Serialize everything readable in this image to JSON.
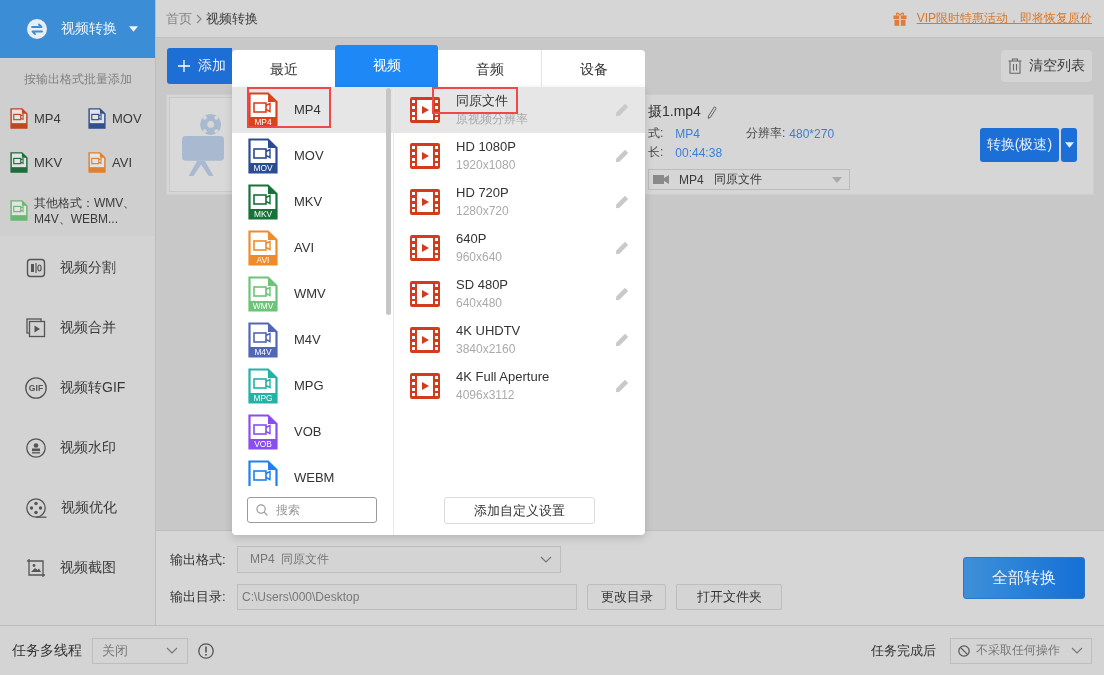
{
  "sidebar": {
    "module": {
      "title": "视频转换"
    },
    "batch_label": "按输出格式批量添加",
    "formats": [
      {
        "label": "MP4",
        "color": "#c04720"
      },
      {
        "label": "MOV",
        "color": "#32508f"
      },
      {
        "label": "MKV",
        "color": "#1e6e3d"
      },
      {
        "label": "AVI",
        "color": "#e0812f"
      }
    ],
    "other_formats": {
      "label": "其他格式：WMV、M4V、WEBM...",
      "color": "#6ab774"
    },
    "tools": [
      {
        "label": "视频分割",
        "kind": "split"
      },
      {
        "label": "视频合并",
        "kind": "merge"
      },
      {
        "label": "视频转GIF",
        "kind": "gif",
        "badge": "GIF"
      },
      {
        "label": "视频水印",
        "kind": "watermark"
      },
      {
        "label": "视频优化",
        "kind": "enhance"
      },
      {
        "label": "视频截图",
        "kind": "screenshot"
      }
    ]
  },
  "breadcrumb": [
    "首页",
    "视频转换"
  ],
  "promo": {
    "text": "VIP限时特惠活动，即将恢复原价"
  },
  "toolbar": {
    "add_button": "添加",
    "clear_button": "清空列表"
  },
  "file": {
    "name": "摄1.mp4",
    "format_label": "式:",
    "format": "MP4",
    "resolution_label": "分辨率:",
    "resolution": "480*270",
    "duration_label": "长:",
    "duration": "00:44:38",
    "output_format": "MP4",
    "output_preset": "同原文件",
    "convert_button": "转换(极速)"
  },
  "popup": {
    "tabs": [
      {
        "label": "最近",
        "selected": false
      },
      {
        "label": "视频",
        "selected": true
      },
      {
        "label": "音频",
        "selected": false
      },
      {
        "label": "设备",
        "selected": false
      }
    ],
    "formats": [
      {
        "label": "MP4",
        "badge": "MP4",
        "color": "#d9441c",
        "selected": true,
        "highlighted": true
      },
      {
        "label": "MOV",
        "badge": "MOV",
        "color": "#2b4c93",
        "selected": false,
        "highlighted": false
      },
      {
        "label": "MKV",
        "badge": "MKV",
        "color": "#167339",
        "selected": false,
        "highlighted": false
      },
      {
        "label": "AVI",
        "badge": "AVI",
        "color": "#f08b2c",
        "selected": false,
        "highlighted": false
      },
      {
        "label": "WMV",
        "badge": "WMV",
        "color": "#6bc477",
        "selected": false,
        "highlighted": false
      },
      {
        "label": "M4V",
        "badge": "M4V",
        "color": "#5366b5",
        "selected": false,
        "highlighted": false
      },
      {
        "label": "MPG",
        "badge": "MPG",
        "color": "#20b3a6",
        "selected": false,
        "highlighted": false
      },
      {
        "label": "VOB",
        "badge": "VOB",
        "color": "#8a4ef0",
        "selected": false,
        "highlighted": false
      },
      {
        "label": "WEBM",
        "color": "#1f80f0",
        "selected": false,
        "highlighted": false
      }
    ],
    "search": {
      "placeholder": "搜索"
    },
    "presets": [
      {
        "name": "同原文件",
        "detail": "原视频分辨率",
        "selected": true,
        "highlighted": true
      },
      {
        "name": "HD 1080P",
        "detail": "1920x1080",
        "selected": false,
        "highlighted": false
      },
      {
        "name": "HD 720P",
        "detail": "1280x720",
        "selected": false,
        "highlighted": false
      },
      {
        "name": "640P",
        "detail": "960x640",
        "selected": false,
        "highlighted": false
      },
      {
        "name": "SD 480P",
        "detail": "640x480",
        "selected": false,
        "highlighted": false
      },
      {
        "name": "4K UHDTV",
        "detail": "3840x2160",
        "selected": false,
        "highlighted": false
      },
      {
        "name": "4K Full Aperture",
        "detail": "4096x3112",
        "selected": false,
        "highlighted": false
      }
    ],
    "custom_button": "添加自定义设置"
  },
  "output": {
    "format_label": "输出格式:",
    "format_value": "MP4  同原文件",
    "dir_label": "输出目录:",
    "dir_value": "C:\\Users\\000\\Desktop",
    "change_dir_button": "更改目录",
    "open_folder_button": "打开文件夹",
    "convert_all_button": "全部转换"
  },
  "status_bar": {
    "threads_label": "任务多线程",
    "threads_value": "关闭",
    "after_label": "任务完成后",
    "after_value": "不采取任何操作"
  }
}
